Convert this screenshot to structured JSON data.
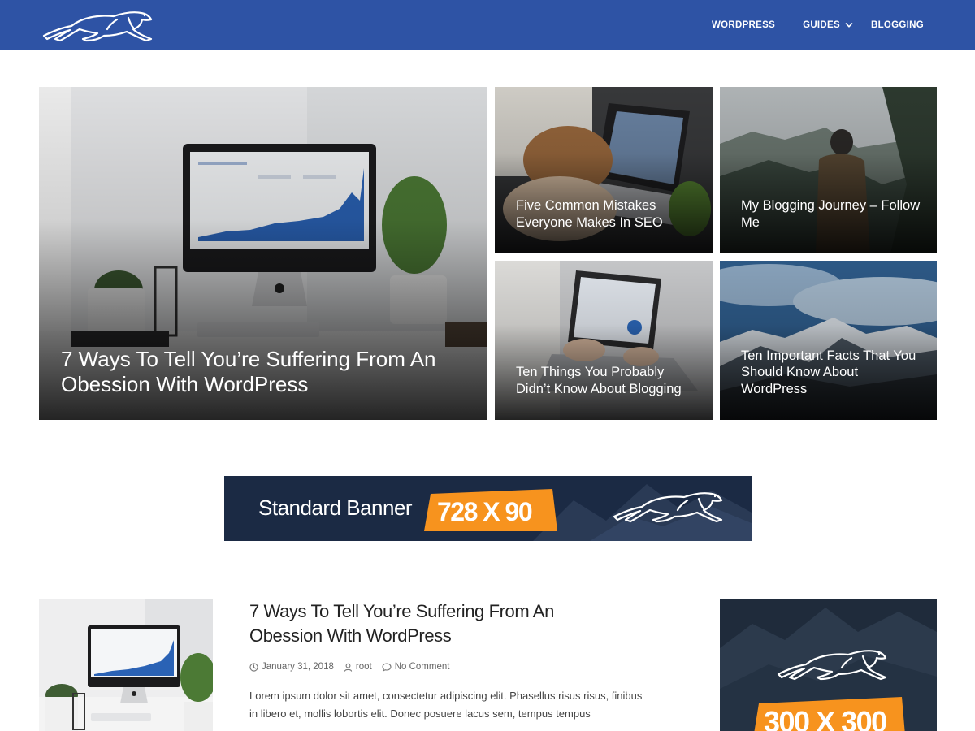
{
  "header": {
    "logo_name": "cheetah-logo",
    "nav": [
      {
        "label": "WORDPRESS"
      },
      {
        "label": "GUIDES"
      },
      {
        "label": "BLOGGING"
      }
    ],
    "bg_color": "#2e53a5"
  },
  "featured": {
    "main": {
      "title": "7 Ways To Tell You’re Suffering From An Obession With WordPress"
    },
    "tiles": [
      {
        "title": "Five Common Mistakes Everyone Makes In SEO"
      },
      {
        "title": "My Blogging Journey – Follow Me"
      },
      {
        "title": "Ten Things You Probably Didn’t Know About Blogging"
      },
      {
        "title": "Ten Important Facts That You Should Know About WordPress"
      }
    ]
  },
  "banner": {
    "text": "Standard Banner",
    "size": "728 X 90",
    "accent": "#f7931e"
  },
  "post": {
    "title": "7 Ways To Tell You’re Suffering From An Obession With WordPress",
    "date": "January 31, 2018",
    "author": "root",
    "comments": "No Comment",
    "excerpt": "Lorem ipsum dolor sit amet, consectetur adipiscing elit. Phasellus risus risus, finibus in libero et, mollis lobortis elit. Donec posuere lacus sem, tempus tempus"
  },
  "sidebar_ad": {
    "size": "300 X 300"
  }
}
